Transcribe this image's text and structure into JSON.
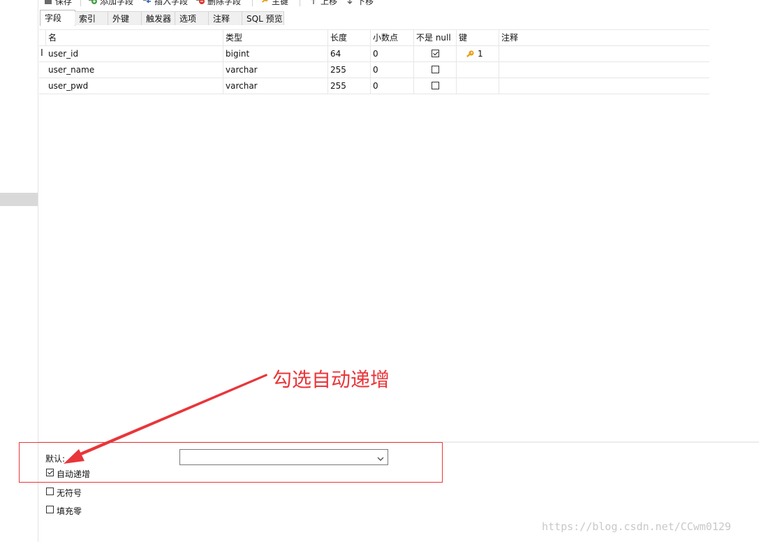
{
  "toolbar": {
    "items": [
      {
        "label": "保存"
      },
      {
        "label": "添加字段"
      },
      {
        "label": "插入字段"
      },
      {
        "label": "删除字段"
      },
      {
        "label": "主键"
      },
      {
        "label": "上移"
      },
      {
        "label": "下移"
      }
    ]
  },
  "tabs": [
    {
      "label": "字段",
      "active": true
    },
    {
      "label": "索引"
    },
    {
      "label": "外键"
    },
    {
      "label": "触发器"
    },
    {
      "label": "选项"
    },
    {
      "label": "注释"
    },
    {
      "label": "SQL 预览"
    }
  ],
  "grid": {
    "columns": [
      "名",
      "类型",
      "长度",
      "小数点",
      "不是 null",
      "键",
      "注释"
    ],
    "rows": [
      {
        "name": "user_id",
        "type": "bigint",
        "length": "64",
        "decimals": "0",
        "not_null": true,
        "key": "1",
        "comment": ""
      },
      {
        "name": "user_name",
        "type": "varchar",
        "length": "255",
        "decimals": "0",
        "not_null": false,
        "key": "",
        "comment": ""
      },
      {
        "name": "user_pwd",
        "type": "varchar",
        "length": "255",
        "decimals": "0",
        "not_null": false,
        "key": "",
        "comment": ""
      }
    ],
    "row_marker": "I"
  },
  "props": {
    "default_label": "默认:",
    "default_value": "",
    "auto_increment_label": "自动递增",
    "auto_increment_checked": true,
    "unsigned_label": "无符号",
    "unsigned_checked": false,
    "zerofill_label": "填充零",
    "zerofill_checked": false
  },
  "annotation": {
    "text": "勾选自动递增",
    "color": "#e8363a"
  },
  "watermark": "https://blog.csdn.net/CCwm0129",
  "colors": {
    "key_icon": "#e6a21a",
    "annotation": "#e8363a"
  }
}
